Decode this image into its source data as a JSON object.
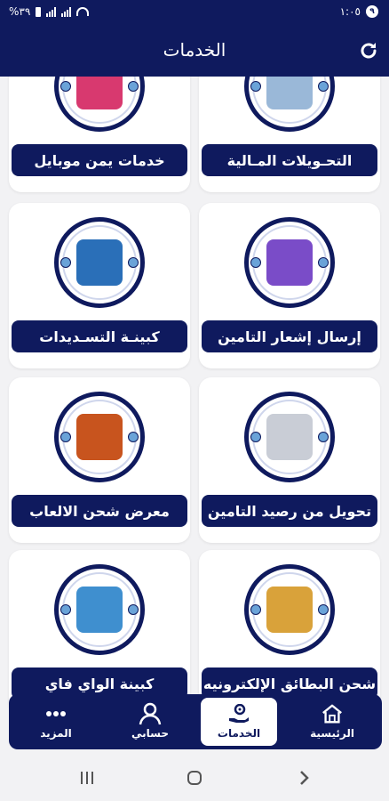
{
  "status": {
    "time": "١:٠٥",
    "battery": "%٣٩",
    "badge": "٩"
  },
  "header": {
    "title": "الخدمات"
  },
  "services": [
    {
      "label": "خدمات يمن موبايل",
      "art_color": "#d8396f"
    },
    {
      "label": "التحـويلات المـالية",
      "art_color": "#9ab8d8"
    },
    {
      "label": "كبينـة التسـديدات",
      "art_color": "#2a6fb8"
    },
    {
      "label": "إرسال إشعار التامين",
      "art_color": "#7a4cc8"
    },
    {
      "label": "معرض شحن الالعاب",
      "art_color": "#c8541e"
    },
    {
      "label": "تحويل من رصيد التامين",
      "art_color": "#c9cdd6"
    },
    {
      "label": "كبينة الواي فاي",
      "art_color": "#3f8fcf"
    },
    {
      "label": "شحن البطائق الإلكترونيه",
      "art_color": "#d9a23a"
    }
  ],
  "nav": {
    "home": "الرئيسية",
    "services": "الخدمات",
    "account": "حسابي",
    "more": "المزيد"
  },
  "colors": {
    "brand": "#0f1a5e",
    "background": "#f2f2f4"
  }
}
